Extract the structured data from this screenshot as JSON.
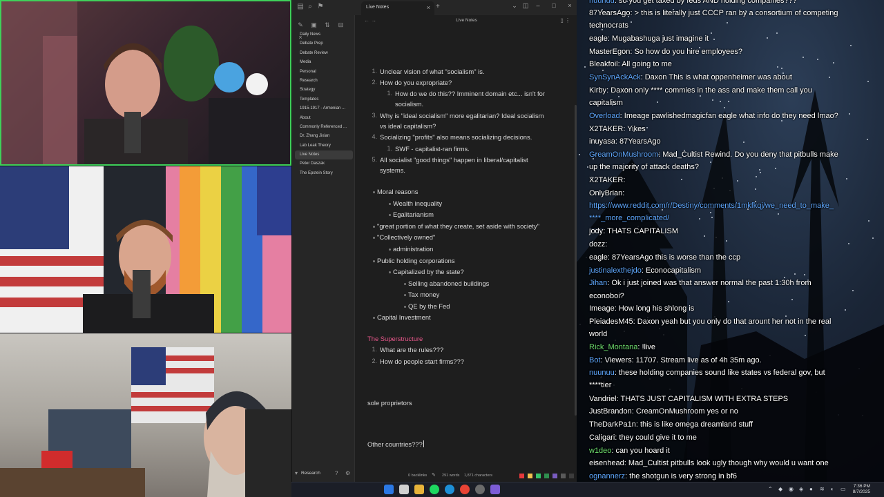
{
  "app": {
    "tab_title": "Live Notes",
    "note_title": "Live Notes",
    "vault_name": "Research",
    "folders": [
      "Daily News",
      "Debate Prep",
      "Debate Review",
      "Media",
      "Personal",
      "Research",
      "Strategy",
      "Templates",
      "1915-1917 - Armenian ...",
      "About",
      "Commonly Referenced ...",
      "Dr. Zhang Jixian",
      "Lab Leak Theory",
      "Live Notes",
      "Peter Daszak",
      "The Epstein Story"
    ],
    "active_folder": "Live Notes",
    "status": {
      "backlinks": "0 backlinks",
      "words": "291 words",
      "characters": "1,871 characters"
    },
    "swatch_colors": [
      "#e5383b",
      "#f2c14e",
      "#35c46b",
      "#2f8f4e",
      "#7a5cc0",
      "#5a5a5a",
      "#3c3c3c",
      "#2a2a2a"
    ]
  },
  "note": {
    "list1": [
      {
        "n": "1.",
        "text": "Unclear vision of what \"socialism\" is."
      },
      {
        "n": "2.",
        "text": "How do you expropriate?"
      },
      {
        "n": "1.",
        "text": "How do we do this?? Imminent domain etc... isn't for"
      },
      {
        "n": "",
        "text": "socialism."
      },
      {
        "n": "3.",
        "text": "Why is \"ideal socialism\" more egalitarian? Ideal socialism"
      },
      {
        "n": "",
        "text": "vs ideal capitalism?"
      },
      {
        "n": "4.",
        "text": "Socializing \"profits\" also means socializing decisions."
      },
      {
        "n": "1.",
        "text": "SWF - capitalist-ran firms."
      },
      {
        "n": "5.",
        "text": "All socialist \"good things\" happen in liberal/capitalist"
      },
      {
        "n": "",
        "text": "systems."
      }
    ],
    "bullets": [
      "Moral reasons",
      "Wealth inequality",
      "Egalitarianism",
      "\"great portion of what they create, set aside with society\"",
      "\"Collectively owned\"",
      "administration",
      "Public holding corporations",
      "Capitalized by the state?",
      "Selling abandoned buildings",
      "Tax money",
      "QE by the Fed",
      "Capital Investment"
    ],
    "heading": "The Superstructure",
    "list2": [
      {
        "n": "1.",
        "text": "What are the rules???"
      },
      {
        "n": "2.",
        "text": "How do people start firms???"
      }
    ],
    "para1": "sole proprietors",
    "para2": "Other countries???"
  },
  "chat": {
    "messages": [
      {
        "user": "nuunuu",
        "color": "#5fa8ff",
        "text": "so you get taxed by feds AND holding companies???"
      },
      {
        "user": "87YearsAgo",
        "color": "#ffffff",
        "text": "> this is literally just CCCP ran by a consortium of competing"
      },
      {
        "user": "",
        "color": "#ffffff",
        "text": "technocrats"
      },
      {
        "user": "eagle",
        "color": "#ffffff",
        "text": "Mugabashuga just imagine it"
      },
      {
        "user": "MasterEgon",
        "color": "#ffffff",
        "text": "So how do you hire employees?"
      },
      {
        "user": "Bleakfoil",
        "color": "#ffffff",
        "text": "All going to me"
      },
      {
        "user": "SynSynAckAck",
        "color": "#5fa8ff",
        "text": "Daxon This is what oppenheimer was about"
      },
      {
        "user": "Kirby",
        "color": "#ffffff",
        "text": "Daxon only **** commies in the ass and make them call you"
      },
      {
        "user": "",
        "color": "#ffffff",
        "text": "capitalism"
      },
      {
        "user": "Overload",
        "color": "#5fa8ff",
        "text": "Imeage pawlishedmagicfan eagle what info do they need lmao?"
      },
      {
        "user": "X2TAKER",
        "color": "#ffffff",
        "text": "Yikes"
      },
      {
        "user": "inuyasa",
        "color": "#ffffff",
        "text": "87YearsAgo"
      },
      {
        "user": "GreamOnMushroom",
        "color": "#5fa8ff",
        "text": "Mad_Cultist Rewind. Do you deny that pitbulls make"
      },
      {
        "user": "",
        "color": "#ffffff",
        "text": "up the majority of attack deaths?"
      },
      {
        "user": "X2TAKER",
        "color": "#ffffff",
        "text": ""
      },
      {
        "user": "OnlyBrian",
        "color": "#ffffff",
        "text": ""
      },
      {
        "user": "",
        "color": "#5fa8ff",
        "text": "https://www.reddit.com/r/Destiny/comments/1mkfkqj/we_need_to_make_"
      },
      {
        "user": "",
        "color": "#5fa8ff",
        "text": "****_more_complicated/"
      },
      {
        "user": "jody",
        "color": "#ffffff",
        "text": "THATS CAPITALISM"
      },
      {
        "user": "dozz",
        "color": "#ffffff",
        "text": ""
      },
      {
        "user": "eagle",
        "color": "#ffffff",
        "text": "87YearsAgo this is worse than the ccp"
      },
      {
        "user": "justinalexthejdo",
        "color": "#5fa8ff",
        "text": "Econocapitalism"
      },
      {
        "user": "Jihan",
        "color": "#5fa8ff",
        "text": "Ok i just joined was that answer normal the past 1:30h from"
      },
      {
        "user": "",
        "color": "#ffffff",
        "text": "econoboi?"
      },
      {
        "user": "Imeage",
        "color": "#ffffff",
        "text": "How long his shlong is"
      },
      {
        "user": "PleiadesM45",
        "color": "#ffffff",
        "text": "Daxon yeah but you only do that arount her  not in the real"
      },
      {
        "user": "",
        "color": "#ffffff",
        "text": "world"
      },
      {
        "user": "Rick_Montana",
        "color": "#6fe06f",
        "text": "!live"
      },
      {
        "user": "Bot",
        "color": "#5fa8ff",
        "text": "Viewers: 11707. Stream live as of 4h 35m ago."
      },
      {
        "user": "nuunuu",
        "color": "#5fa8ff",
        "text": "these holding companies sound like states vs federal gov, but"
      },
      {
        "user": "",
        "color": "#ffffff",
        "text": "****tier"
      },
      {
        "user": "Vandriel",
        "color": "#ffffff",
        "text": "THATS JUST CAPITALISM WITH EXTRA STEPS"
      },
      {
        "user": "JustBrandon",
        "color": "#ffffff",
        "text": "CreamOnMushroom yes or no"
      },
      {
        "user": "TheDarkPa1n",
        "color": "#ffffff",
        "text": "this is like omega dreamland stuff"
      },
      {
        "user": "Caligari",
        "color": "#ffffff",
        "text": "they could give it to me"
      },
      {
        "user": "w1deo",
        "color": "#6fe06f",
        "text": "can you hoard it"
      },
      {
        "user": "eisenhead",
        "color": "#ffffff",
        "text": "Mad_Cultist pitbulls look ugly though why would u want one"
      },
      {
        "user": "ognannerz",
        "color": "#5fa8ff",
        "text": "the shotgun is very strong in bf6"
      }
    ]
  },
  "taskbar": {
    "time": "7:36 PM",
    "date": "8/7/2025"
  }
}
